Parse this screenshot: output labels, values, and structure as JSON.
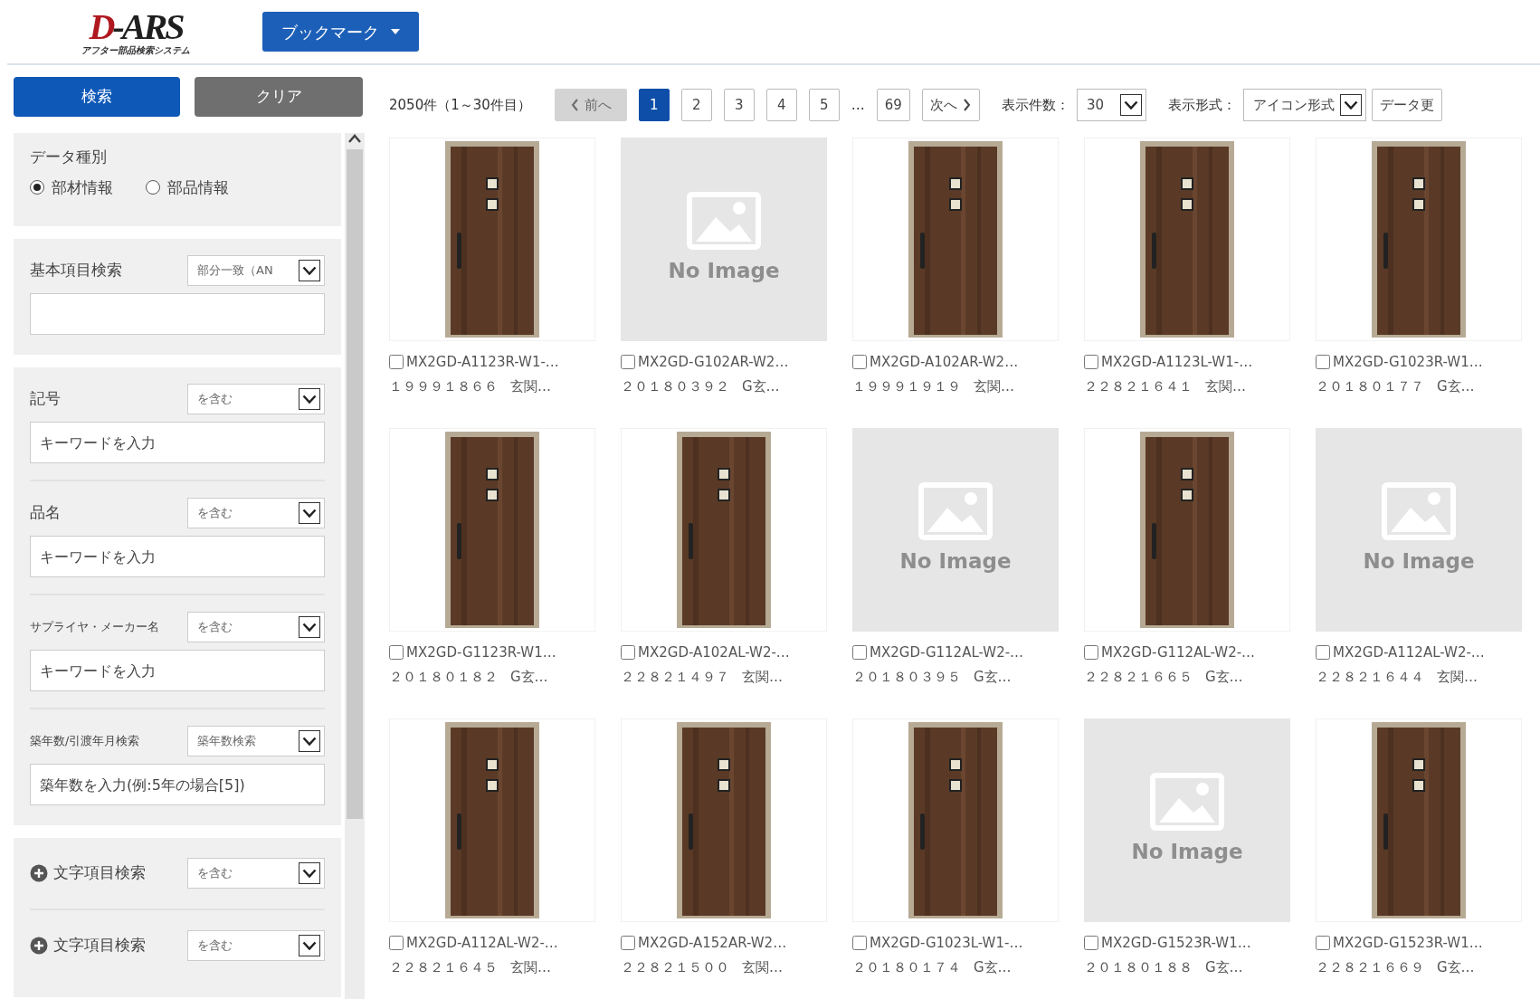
{
  "header": {
    "logo": "D-ARS",
    "logo_subtitle": "アフター部品検索システム",
    "bookmark_button": "ブックマーク"
  },
  "sidebar": {
    "search_button": "検索",
    "clear_button": "クリア",
    "sections": [
      {
        "kind": "radio",
        "title": "データ種別",
        "options": [
          {
            "label": "部材情報",
            "selected": true
          },
          {
            "label": "部品情報",
            "selected": false
          }
        ]
      },
      {
        "kind": "fields",
        "fields": [
          {
            "label": "基本項目検索",
            "mode": "部分一致（AN"
          }
        ]
      },
      {
        "kind": "fields",
        "fields": [
          {
            "label": "記号",
            "mode": "を含む",
            "placeholder": "キーワードを入力"
          },
          {
            "label": "品名",
            "mode": "を含む",
            "placeholder": "キーワードを入力"
          },
          {
            "label": "サプライヤ・メーカー名",
            "mode": "を含む",
            "placeholder": "キーワードを入力"
          },
          {
            "label": "築年数/引渡年月検索",
            "mode": "築年数検索",
            "placeholder": "築年数を入力(例:5年の場合[5])"
          }
        ]
      },
      {
        "kind": "add",
        "rows": [
          {
            "label": "文字項目検索",
            "mode": "を含む"
          },
          {
            "label": "文字項目検索",
            "mode": "を含む"
          }
        ]
      }
    ]
  },
  "toolbar": {
    "count": "2050件（1～30件目）",
    "prev": {
      "label": "前へ",
      "disabled": true
    },
    "pages": [
      {
        "label": "1",
        "selected": true
      },
      {
        "label": "2",
        "selected": false
      },
      {
        "label": "3",
        "selected": false
      },
      {
        "label": "4",
        "selected": false
      },
      {
        "label": "5",
        "selected": false
      }
    ],
    "ellipsis": "…",
    "last_page": "69",
    "next": {
      "label": "次へ",
      "disabled": false
    },
    "per_page_label": "表示件数：",
    "per_page": "30",
    "view_label": "表示形式：",
    "view": "アイコン形式",
    "update_button": "データ更"
  },
  "results": [
    {
      "kind": "picture",
      "checked": false,
      "code": "MX2GD-A1123R-W1-…",
      "number": "１９９９１８６６",
      "category": "玄関…"
    },
    {
      "kind": "no_image",
      "no_image_text": "No Image",
      "checked": false,
      "code": "MX2GD-G102AR-W2…",
      "number": "２０１８０３９２",
      "category": "G玄…"
    },
    {
      "kind": "picture",
      "checked": false,
      "code": "MX2GD-A102AR-W2…",
      "number": "１９９９１９１９",
      "category": "玄関…"
    },
    {
      "kind": "picture",
      "checked": false,
      "code": "MX2GD-A1123L-W1-…",
      "number": "２２８２１６４１",
      "category": "玄関…"
    },
    {
      "kind": "picture",
      "checked": false,
      "code": "MX2GD-G1023R-W1…",
      "number": "２０１８０１７７",
      "category": "G玄…"
    },
    {
      "kind": "picture",
      "checked": false,
      "code": "MX2GD-G1123R-W1…",
      "number": "２０１８０１８２",
      "category": "G玄…"
    },
    {
      "kind": "picture",
      "checked": false,
      "code": "MX2GD-A102AL-W2-…",
      "number": "２２８２１４９７",
      "category": "玄関…"
    },
    {
      "kind": "no_image",
      "no_image_text": "No Image",
      "checked": false,
      "code": "MX2GD-G112AL-W2-…",
      "number": "２０１８０３９５",
      "category": "G玄…"
    },
    {
      "kind": "picture",
      "checked": false,
      "code": "MX2GD-G112AL-W2-…",
      "number": "２２８２１６６５",
      "category": "G玄…"
    },
    {
      "kind": "no_image",
      "no_image_text": "No Image",
      "checked": false,
      "code": "MX2GD-A112AL-W2-…",
      "number": "２２８２１６４４",
      "category": "玄関…"
    },
    {
      "kind": "picture",
      "checked": false,
      "code": "MX2GD-A112AL-W2-…",
      "number": "２２８２１６４５",
      "category": "玄関…"
    },
    {
      "kind": "picture",
      "checked": false,
      "code": "MX2GD-A152AR-W2…",
      "number": "２２８２１５００",
      "category": "玄関…"
    },
    {
      "kind": "picture",
      "checked": false,
      "code": "MX2GD-G1023L-W1-…",
      "number": "２０１８０１７４",
      "category": "G玄…"
    },
    {
      "kind": "no_image",
      "no_image_text": "No Image",
      "checked": false,
      "code": "MX2GD-G1523R-W1…",
      "number": "２０１８０１８８",
      "category": "G玄…"
    },
    {
      "kind": "picture",
      "checked": false,
      "code": "MX2GD-G1523R-W1…",
      "number": "２２８２１６６９",
      "category": "G玄…"
    }
  ]
}
